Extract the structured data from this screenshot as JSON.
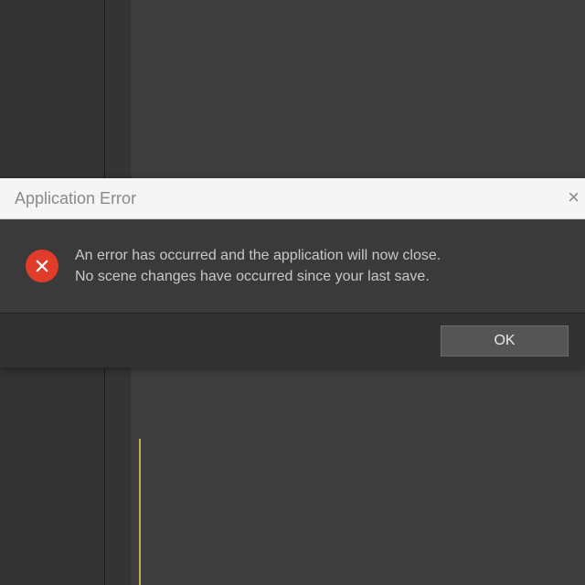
{
  "dialog": {
    "title": "Application Error",
    "message_line1": "An error has occurred and the application will now close.",
    "message_line2": "No scene changes have occurred since your last save.",
    "ok_label": "OK",
    "icon_name": "error-x-icon"
  }
}
